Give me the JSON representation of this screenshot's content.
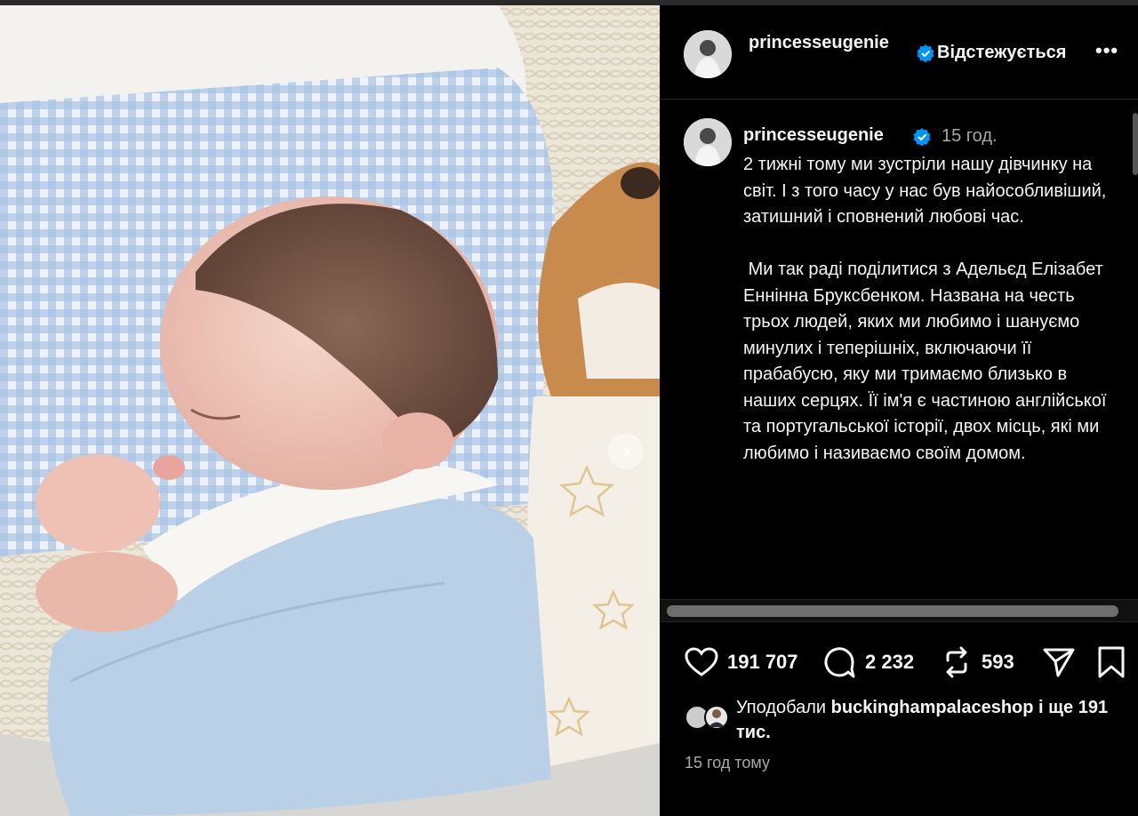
{
  "post": {
    "username": "princesseugenie",
    "follow_status": "Відстежується",
    "more_label": "•••",
    "caption_user": "princesseugenie",
    "caption_time": "15 год.",
    "caption_text": "2 тижні тому ми зустріли нашу дівчинку на світ. І з того часу у нас був найособливіший, затишний і сповнений любові час.\n\n Ми так раді поділитися з Адельєд Елізабет Еннінна Бруксбенком. Названа на честь трьох людей, яких ми любимо і шануємо минулих і теперішніх, включаючи її прабабусю, яку ми тримаємо близько в наших серцях. Її ім'я є частиною англійської та португальської історії, двох місць, які ми любимо і називаємо своїм домом.",
    "likes_count": "191 707",
    "comments_count": "2 232",
    "reposts_count": "593",
    "liked_by_prefix": "Уподобали",
    "liked_by_user": "buckinghampalaceshop",
    "liked_by_suffix": " і ще 191 тис.",
    "posted_ago": "15 год тому"
  },
  "icons": [
    "heart-icon",
    "comment-icon",
    "repost-icon",
    "share-icon",
    "bookmark-icon",
    "verified-icon",
    "chevron-right-icon",
    "more-icon"
  ],
  "colors": {
    "background": "#000000",
    "text": "#f5f5f5",
    "muted": "#a8a8a8",
    "verified": "#0095f6"
  }
}
